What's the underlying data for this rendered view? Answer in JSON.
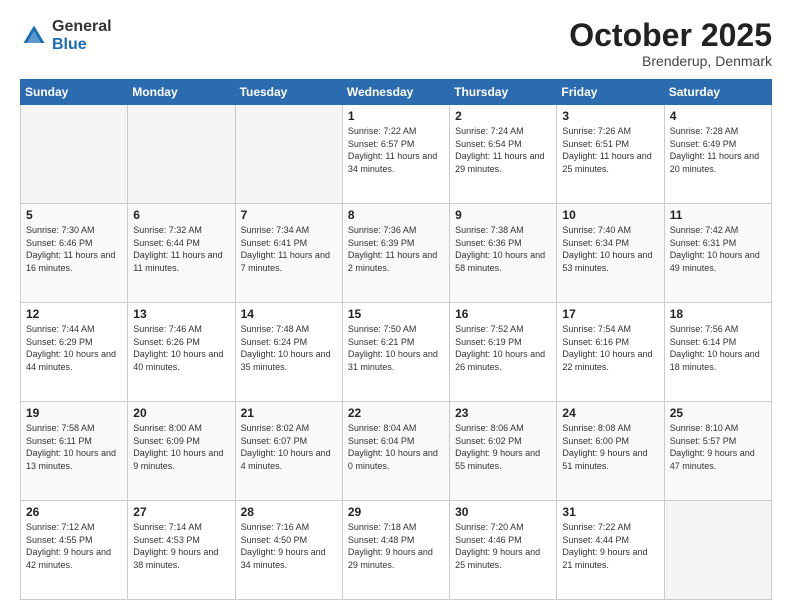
{
  "header": {
    "logo_general": "General",
    "logo_blue": "Blue",
    "title": "October 2025",
    "subtitle": "Brenderup, Denmark"
  },
  "days_of_week": [
    "Sunday",
    "Monday",
    "Tuesday",
    "Wednesday",
    "Thursday",
    "Friday",
    "Saturday"
  ],
  "weeks": [
    [
      {
        "day": "",
        "sunrise": "",
        "sunset": "",
        "daylight": "",
        "empty": true
      },
      {
        "day": "",
        "sunrise": "",
        "sunset": "",
        "daylight": "",
        "empty": true
      },
      {
        "day": "",
        "sunrise": "",
        "sunset": "",
        "daylight": "",
        "empty": true
      },
      {
        "day": "1",
        "sunrise": "Sunrise: 7:22 AM",
        "sunset": "Sunset: 6:57 PM",
        "daylight": "Daylight: 11 hours and 34 minutes."
      },
      {
        "day": "2",
        "sunrise": "Sunrise: 7:24 AM",
        "sunset": "Sunset: 6:54 PM",
        "daylight": "Daylight: 11 hours and 29 minutes."
      },
      {
        "day": "3",
        "sunrise": "Sunrise: 7:26 AM",
        "sunset": "Sunset: 6:51 PM",
        "daylight": "Daylight: 11 hours and 25 minutes."
      },
      {
        "day": "4",
        "sunrise": "Sunrise: 7:28 AM",
        "sunset": "Sunset: 6:49 PM",
        "daylight": "Daylight: 11 hours and 20 minutes."
      }
    ],
    [
      {
        "day": "5",
        "sunrise": "Sunrise: 7:30 AM",
        "sunset": "Sunset: 6:46 PM",
        "daylight": "Daylight: 11 hours and 16 minutes."
      },
      {
        "day": "6",
        "sunrise": "Sunrise: 7:32 AM",
        "sunset": "Sunset: 6:44 PM",
        "daylight": "Daylight: 11 hours and 11 minutes."
      },
      {
        "day": "7",
        "sunrise": "Sunrise: 7:34 AM",
        "sunset": "Sunset: 6:41 PM",
        "daylight": "Daylight: 11 hours and 7 minutes."
      },
      {
        "day": "8",
        "sunrise": "Sunrise: 7:36 AM",
        "sunset": "Sunset: 6:39 PM",
        "daylight": "Daylight: 11 hours and 2 minutes."
      },
      {
        "day": "9",
        "sunrise": "Sunrise: 7:38 AM",
        "sunset": "Sunset: 6:36 PM",
        "daylight": "Daylight: 10 hours and 58 minutes."
      },
      {
        "day": "10",
        "sunrise": "Sunrise: 7:40 AM",
        "sunset": "Sunset: 6:34 PM",
        "daylight": "Daylight: 10 hours and 53 minutes."
      },
      {
        "day": "11",
        "sunrise": "Sunrise: 7:42 AM",
        "sunset": "Sunset: 6:31 PM",
        "daylight": "Daylight: 10 hours and 49 minutes."
      }
    ],
    [
      {
        "day": "12",
        "sunrise": "Sunrise: 7:44 AM",
        "sunset": "Sunset: 6:29 PM",
        "daylight": "Daylight: 10 hours and 44 minutes."
      },
      {
        "day": "13",
        "sunrise": "Sunrise: 7:46 AM",
        "sunset": "Sunset: 6:26 PM",
        "daylight": "Daylight: 10 hours and 40 minutes."
      },
      {
        "day": "14",
        "sunrise": "Sunrise: 7:48 AM",
        "sunset": "Sunset: 6:24 PM",
        "daylight": "Daylight: 10 hours and 35 minutes."
      },
      {
        "day": "15",
        "sunrise": "Sunrise: 7:50 AM",
        "sunset": "Sunset: 6:21 PM",
        "daylight": "Daylight: 10 hours and 31 minutes."
      },
      {
        "day": "16",
        "sunrise": "Sunrise: 7:52 AM",
        "sunset": "Sunset: 6:19 PM",
        "daylight": "Daylight: 10 hours and 26 minutes."
      },
      {
        "day": "17",
        "sunrise": "Sunrise: 7:54 AM",
        "sunset": "Sunset: 6:16 PM",
        "daylight": "Daylight: 10 hours and 22 minutes."
      },
      {
        "day": "18",
        "sunrise": "Sunrise: 7:56 AM",
        "sunset": "Sunset: 6:14 PM",
        "daylight": "Daylight: 10 hours and 18 minutes."
      }
    ],
    [
      {
        "day": "19",
        "sunrise": "Sunrise: 7:58 AM",
        "sunset": "Sunset: 6:11 PM",
        "daylight": "Daylight: 10 hours and 13 minutes."
      },
      {
        "day": "20",
        "sunrise": "Sunrise: 8:00 AM",
        "sunset": "Sunset: 6:09 PM",
        "daylight": "Daylight: 10 hours and 9 minutes."
      },
      {
        "day": "21",
        "sunrise": "Sunrise: 8:02 AM",
        "sunset": "Sunset: 6:07 PM",
        "daylight": "Daylight: 10 hours and 4 minutes."
      },
      {
        "day": "22",
        "sunrise": "Sunrise: 8:04 AM",
        "sunset": "Sunset: 6:04 PM",
        "daylight": "Daylight: 10 hours and 0 minutes."
      },
      {
        "day": "23",
        "sunrise": "Sunrise: 8:06 AM",
        "sunset": "Sunset: 6:02 PM",
        "daylight": "Daylight: 9 hours and 55 minutes."
      },
      {
        "day": "24",
        "sunrise": "Sunrise: 8:08 AM",
        "sunset": "Sunset: 6:00 PM",
        "daylight": "Daylight: 9 hours and 51 minutes."
      },
      {
        "day": "25",
        "sunrise": "Sunrise: 8:10 AM",
        "sunset": "Sunset: 5:57 PM",
        "daylight": "Daylight: 9 hours and 47 minutes."
      }
    ],
    [
      {
        "day": "26",
        "sunrise": "Sunrise: 7:12 AM",
        "sunset": "Sunset: 4:55 PM",
        "daylight": "Daylight: 9 hours and 42 minutes."
      },
      {
        "day": "27",
        "sunrise": "Sunrise: 7:14 AM",
        "sunset": "Sunset: 4:53 PM",
        "daylight": "Daylight: 9 hours and 38 minutes."
      },
      {
        "day": "28",
        "sunrise": "Sunrise: 7:16 AM",
        "sunset": "Sunset: 4:50 PM",
        "daylight": "Daylight: 9 hours and 34 minutes."
      },
      {
        "day": "29",
        "sunrise": "Sunrise: 7:18 AM",
        "sunset": "Sunset: 4:48 PM",
        "daylight": "Daylight: 9 hours and 29 minutes."
      },
      {
        "day": "30",
        "sunrise": "Sunrise: 7:20 AM",
        "sunset": "Sunset: 4:46 PM",
        "daylight": "Daylight: 9 hours and 25 minutes."
      },
      {
        "day": "31",
        "sunrise": "Sunrise: 7:22 AM",
        "sunset": "Sunset: 4:44 PM",
        "daylight": "Daylight: 9 hours and 21 minutes."
      },
      {
        "day": "",
        "sunrise": "",
        "sunset": "",
        "daylight": "",
        "empty": true
      }
    ]
  ]
}
